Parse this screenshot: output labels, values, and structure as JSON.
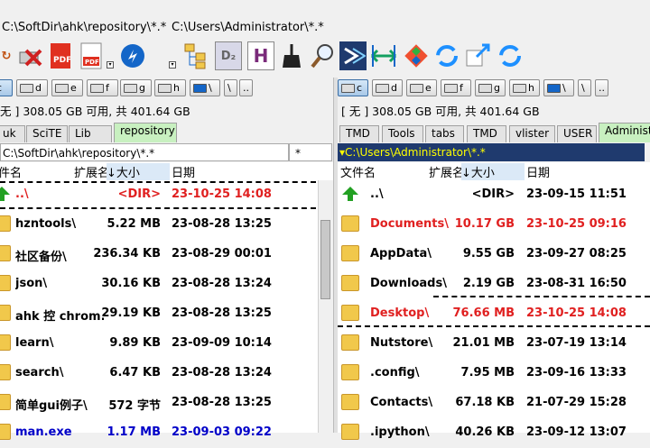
{
  "top_paths": {
    "left": "C:\\SoftDir\\ahk\\repository\\*.*",
    "right": "C:\\Users\\Administrator\\*.*"
  },
  "toolbar": {
    "icons": [
      "refresh-icon",
      "delete-icon",
      "pdf-icon",
      "pdf-convert-icon",
      "edge-icon",
      "tree-icon",
      "d2-icon",
      "h-icon",
      "broom-icon",
      "search-icon",
      "console-icon",
      "sync-dirs-icon",
      "git-icon",
      "sync-icon",
      "new-window-icon",
      "sync-alt-icon"
    ]
  },
  "left": {
    "drives": [
      "c",
      "d",
      "e",
      "f",
      "g",
      "h",
      "\\",
      "..",
      ""
    ],
    "free": "无 ]  308.05 GB 可用, 共 401.64 GB",
    "tabs": [
      {
        "label": "uk"
      },
      {
        "label": "SciTE"
      },
      {
        "label": "Lib"
      },
      {
        "label": "repository"
      }
    ],
    "path": "C:\\SoftDir\\ahk\\repository\\*.*",
    "filter": "*",
    "headers": {
      "name": "件名",
      "ext": "扩展名",
      "size": "大小",
      "date": "日期"
    },
    "rows": [
      {
        "name": "..\\",
        "size": "<DIR>",
        "date": "23-10-25 14:08"
      },
      {
        "name": "hzntools\\",
        "size": "5.22 MB",
        "date": "23-08-28 13:25"
      },
      {
        "name": "社区备份\\",
        "size": "236.34 KB",
        "date": "23-08-29 00:01"
      },
      {
        "name": "json\\",
        "size": "30.16 KB",
        "date": "23-08-28 13:24"
      },
      {
        "name": "ahk 控 chrom...",
        "size": "29.19 KB",
        "date": "23-08-28 13:25"
      },
      {
        "name": "learn\\",
        "size": "9.89 KB",
        "date": "23-09-09 10:14"
      },
      {
        "name": "search\\",
        "size": "6.47 KB",
        "date": "23-08-28 13:24"
      },
      {
        "name": "简单gui例子\\",
        "size": "572 字节",
        "date": "23-08-28 13:25"
      },
      {
        "name": "man.exe",
        "size": "1.17 MB",
        "date": "23-09-03 09:22"
      }
    ]
  },
  "right": {
    "drives": [
      "c",
      "d",
      "e",
      "f",
      "g",
      "h",
      "\\",
      ".."
    ],
    "free": "[ 无 ]  308.05 GB 可用, 共 401.64 GB",
    "tabs": [
      {
        "label": "TMD"
      },
      {
        "label": "Tools"
      },
      {
        "label": "tabs"
      },
      {
        "label": "TMD"
      },
      {
        "label": "vlister"
      },
      {
        "label": "USER"
      },
      {
        "label": "Administ"
      }
    ],
    "path": "C:\\Users\\Administrator\\*.*",
    "headers": {
      "name": "文件名",
      "ext": "扩展名",
      "size": "大小",
      "date": "日期"
    },
    "rows": [
      {
        "name": "..\\",
        "size": "<DIR>",
        "date": "23-09-15 11:51"
      },
      {
        "name": "Documents\\",
        "size": "10.17 GB",
        "date": "23-10-25 09:16"
      },
      {
        "name": "AppData\\",
        "size": "9.55 GB",
        "date": "23-09-27 08:25"
      },
      {
        "name": "Downloads\\",
        "size": "2.19 GB",
        "date": "23-08-31 16:50"
      },
      {
        "name": "Desktop\\",
        "size": "76.66 MB",
        "date": "23-10-25 14:08"
      },
      {
        "name": "Nutstore\\",
        "size": "21.01 MB",
        "date": "23-07-19 13:14"
      },
      {
        "name": ".config\\",
        "size": "7.95 MB",
        "date": "23-09-16 13:33"
      },
      {
        "name": "Contacts\\",
        "size": "67.18 KB",
        "date": "21-07-29 15:28"
      },
      {
        "name": ".ipython\\",
        "size": "40.26 KB",
        "date": "23-09-12 13:07"
      }
    ]
  },
  "colors": {
    "accent_red": "#e02020",
    "pathbar_bg": "#1f3a6e",
    "pathbar_text": "#ffff00",
    "active_tab_green": "#c8f0c0"
  }
}
